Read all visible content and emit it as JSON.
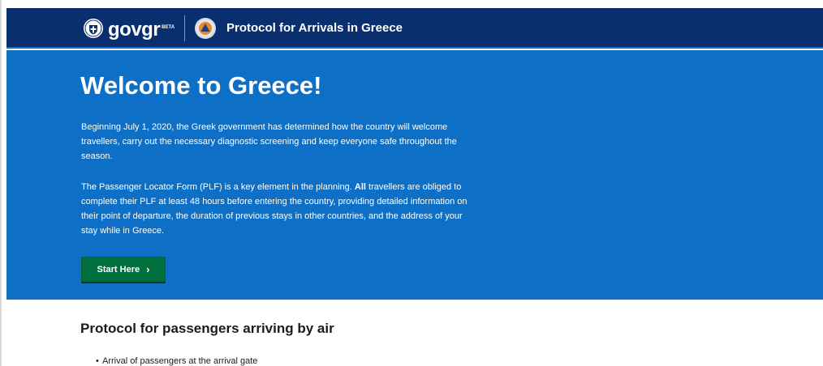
{
  "header": {
    "brand_main": "gov",
    "brand_accent": "gr",
    "brand_badge": "BETA",
    "site_title": "Protocol for Arrivals in Greece",
    "colors": {
      "background": "#0a2f6e",
      "accent_border": "#1b6fc6"
    },
    "icons": {
      "emblem": "greek-coat-of-arms-icon",
      "partner": "civil-protection-icon"
    }
  },
  "hero": {
    "title": "Welcome to Greece!",
    "paragraph1": "Beginning July 1, 2020, the Greek government has determined how the country will welcome travellers, carry out the necessary diagnostic screening and keep everyone safe throughout the season.",
    "paragraph2_before": "The Passenger Locator Form (PLF) is a key element in the planning. ",
    "paragraph2_bold": "All",
    "paragraph2_after": " travellers are obliged to complete their PLF at least 48 hours before entering the country, providing detailed information on their point of departure, the duration of previous stays in other countries, and the address of your stay while in Greece.",
    "cta_label": "Start Here",
    "cta_icon": "chevron-right-icon",
    "colors": {
      "background": "#0d6fc6",
      "cta": "#00703c"
    }
  },
  "main": {
    "section_title": "Protocol for passengers arriving by air",
    "bullets": [
      "Arrival of passengers at the arrival gate"
    ]
  }
}
